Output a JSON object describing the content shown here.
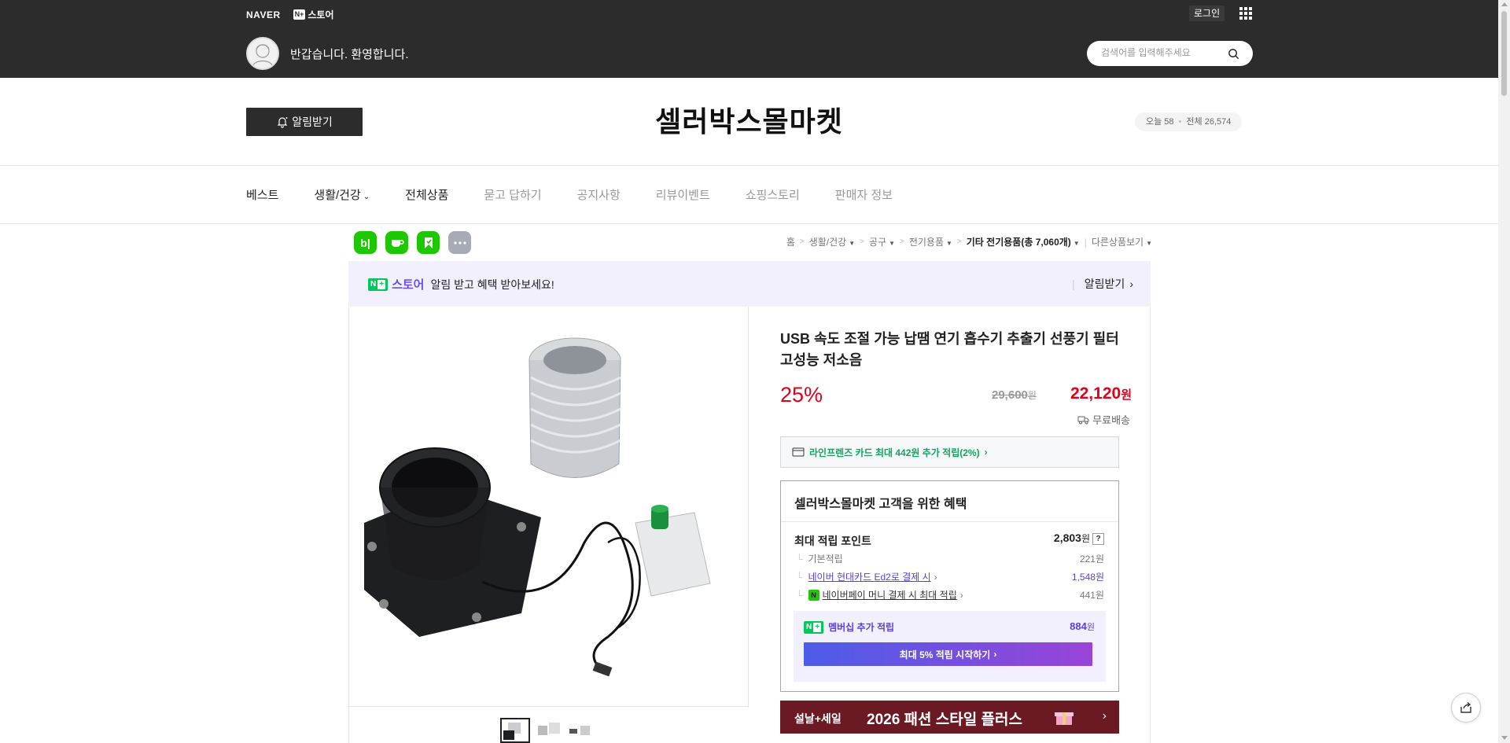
{
  "top": {
    "naver_logo": "NAVER",
    "store_badge": "N+",
    "store_label": "스토어",
    "login_label": "로그인",
    "apps_icon": "grid-icon",
    "welcome_text": "반갑습니다. 환영합니다.",
    "search_placeholder": "검색어를 입력해주세요"
  },
  "store": {
    "notify_label": "알림받기",
    "title": "셀러박스몰마켓",
    "visits_today": "오늘 58",
    "visits_total": "전체 26,574"
  },
  "nav": {
    "items": [
      {
        "label": "베스트"
      },
      {
        "label": "생활/건강"
      },
      {
        "label": "전체상품"
      },
      {
        "label": "묻고 답하기"
      },
      {
        "label": "공지사항"
      },
      {
        "label": "리뷰이벤트"
      },
      {
        "label": "쇼핑스토리"
      },
      {
        "label": "판매자 정보"
      }
    ]
  },
  "breadcrumb": {
    "home": "홈",
    "c1": "생활/건강",
    "c2": "공구",
    "c3": "전기용품",
    "c4": "기타 전기용품(총 7,060개)",
    "other": "다른상품보기"
  },
  "promo": {
    "badge": "N+",
    "store_word": "스토어",
    "message": "알림 받고 혜택 받아보세요!",
    "cta": "알림받기"
  },
  "product": {
    "title": "USB 속도 조절 가능 납땜 연기 흡수기 추출기 선풍기 필터 고성능 저소음",
    "discount": "25%",
    "original_price": "29,600",
    "sale_price": "22,120",
    "won": "원",
    "shipping": "무료배송"
  },
  "card_benefit": {
    "text": "라인프렌즈 카드 최대 442원 추가 적립(2%)"
  },
  "benefit": {
    "title": "셀러박스몰마켓 고객을 위한 혜택",
    "max_point_label": "최대 적립 포인트",
    "max_point_value": "2,803",
    "help": "?",
    "basic_label": "기본적립",
    "basic_value": "221원",
    "card_label": "네이버 현대카드 Ed2로 결제 시",
    "card_value": "1,548원",
    "npay_label": "네이버페이 머니 결제 시 최대 적립",
    "npay_value": "441원",
    "membership_label": "멤버십 추가 적립",
    "membership_value": "884",
    "membership_cta": "최대 5% 적립 시작하기"
  },
  "ad": {
    "small": "설날+세일",
    "big": "2026 패션 스타일 플러스"
  },
  "colors": {
    "topbar": "#2c2c2c",
    "price_red": "#e3001b",
    "naver_green": "#03c75a",
    "purple": "#5a3ee6",
    "ad_bg": "#6b1a23"
  }
}
